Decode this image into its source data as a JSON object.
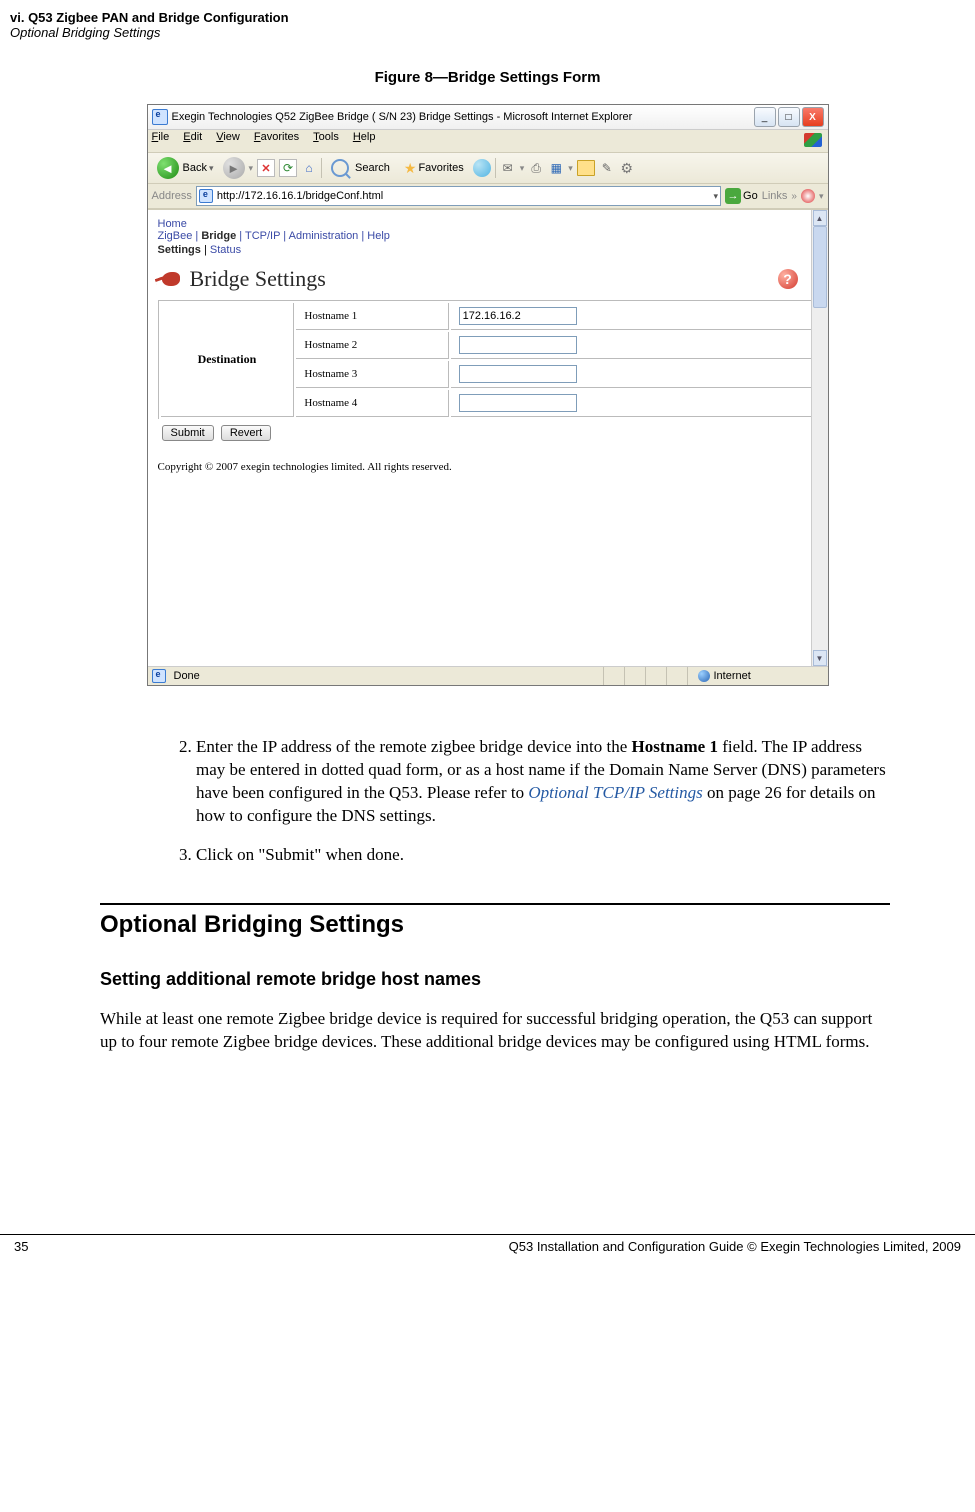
{
  "header": {
    "chapter": "vi. Q53 Zigbee PAN and Bridge Configuration",
    "section_subtitle": "Optional Bridging Settings"
  },
  "figure": {
    "caption": "Figure 8—Bridge Settings Form"
  },
  "browser": {
    "title": "Exegin Technologies Q52 ZigBee Bridge ( S/N 23) Bridge Settings - Microsoft Internet Explorer",
    "menus": {
      "file": "File",
      "edit": "Edit",
      "view": "View",
      "fav": "Favorites",
      "tools": "Tools",
      "help": "Help"
    },
    "toolbar": {
      "back": "Back",
      "search": "Search",
      "favorites": "Favorites"
    },
    "address": {
      "label": "Address",
      "url": "http://172.16.16.1/bridgeConf.html",
      "go": "Go",
      "links": "Links"
    },
    "crumbs": {
      "home": "Home",
      "zigbee": "ZigBee",
      "bridge": "Bridge",
      "tcpip": "TCP/IP",
      "admin": "Administration",
      "help": "Help",
      "settings": "Settings",
      "status": "Status"
    },
    "heading": "Bridge Settings",
    "table": {
      "dest": "Destination",
      "rows": [
        {
          "label": "Hostname 1",
          "value": "172.16.16.2"
        },
        {
          "label": "Hostname 2",
          "value": ""
        },
        {
          "label": "Hostname 3",
          "value": ""
        },
        {
          "label": "Hostname 4",
          "value": ""
        }
      ]
    },
    "buttons": {
      "submit": "Submit",
      "revert": "Revert"
    },
    "copyright": "Copyright © 2007 exegin technologies limited. All rights reserved.",
    "status": {
      "done": "Done",
      "zone": "Internet"
    }
  },
  "steps": {
    "s2_a": "Enter the IP address of the remote zigbee bridge device into the ",
    "s2_b": "Hostname 1",
    "s2_c": " field. The IP address may be entered in dotted quad form, or as a host name if the Domain Name Server (DNS) parameters have been configured in the Q53. Please refer to ",
    "s2_link": "Optional TCP/IP Settings",
    "s2_d": " on page 26 for details on how to configure the DNS settings.",
    "s3": "Click on \"Submit\" when done."
  },
  "sections": {
    "h2": "Optional Bridging Settings",
    "h3": "Setting additional remote bridge host names",
    "para": "While at least one remote Zigbee bridge device is required for successful bridging operation, the Q53 can support up to four remote Zigbee bridge devices. These additional bridge devices may be configured using HTML forms."
  },
  "footer": {
    "page": "35",
    "line": "Q53 Installation and Configuration Guide  © Exegin Technologies Limited, 2009"
  }
}
